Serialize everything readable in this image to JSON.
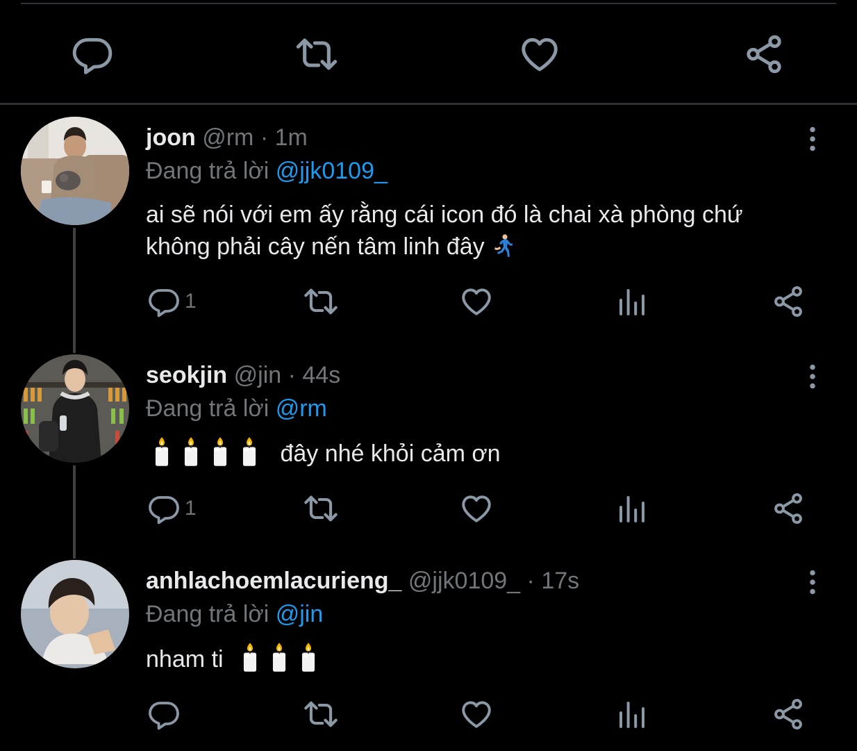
{
  "colors": {
    "accent": "#1d9bf0",
    "icon": "#8b98a5",
    "muted": "#71767b",
    "text": "#e7e9ea",
    "background": "#000000"
  },
  "top_actions": [
    "reply-icon",
    "retweet-icon",
    "like-icon",
    "share-icon"
  ],
  "tweets": [
    {
      "name": "joon",
      "handle": "@rm",
      "sep": "·",
      "time": "1m",
      "reply_prefix": "Đang trả lời",
      "reply_to": "@jjk0109_",
      "text_line1": "ai sẽ nói với em ấy rằng cái icon đó là chai xà phòng chứ",
      "text_line2": "không phải cây nến tâm linh đây",
      "emoji_end": "runner-emoji",
      "reply_count": "1"
    },
    {
      "name": "seokjin",
      "handle": "@jin",
      "sep": "·",
      "time": "44s",
      "reply_prefix": "Đang trả lời",
      "reply_to": "@rm",
      "candles": 4,
      "text": "đây nhé khỏi cảm ơn",
      "reply_count": "1"
    },
    {
      "name": "anhlachoemlacurieng_",
      "handle": "@jjk0109_",
      "sep": "·",
      "time": "17s",
      "reply_prefix": "Đang trả lời",
      "reply_to": "@jin",
      "text": "nham ti",
      "candles": 3,
      "reply_count": ""
    }
  ]
}
